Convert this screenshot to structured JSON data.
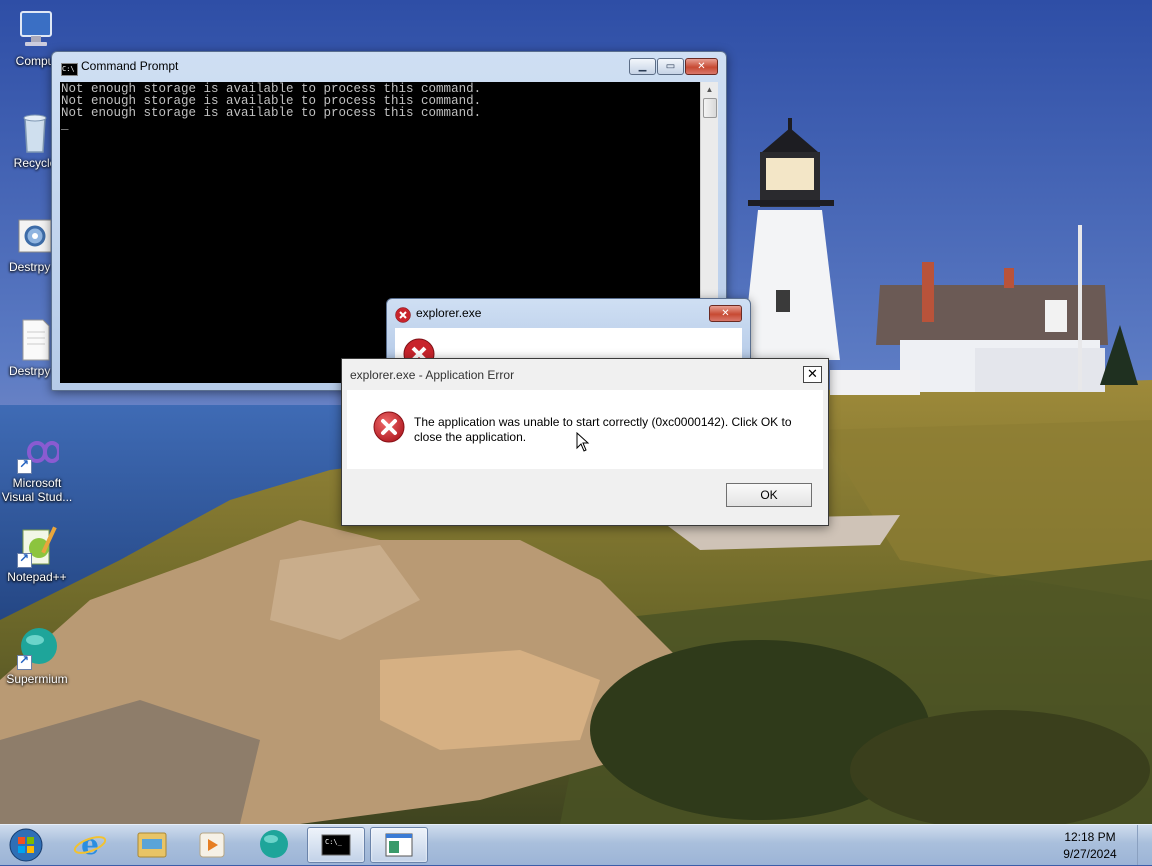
{
  "desktop": {
    "icons": [
      {
        "label": "Compu",
        "icon": "computer-icon"
      },
      {
        "label": "Recycle",
        "icon": "recycle-bin-icon"
      },
      {
        "label": "Destrpy F",
        "icon": "settings-app-icon"
      },
      {
        "label": "Destrpy F",
        "icon": "text-file-icon"
      },
      {
        "label": "Microsoft Visual Stud...",
        "icon": "visual-studio-icon"
      },
      {
        "label": "Notepad++",
        "icon": "notepad-plus-plus-icon"
      },
      {
        "label": "Supermium",
        "icon": "supermium-browser-icon"
      }
    ]
  },
  "cmd_window": {
    "title": "Command Prompt",
    "lines": [
      "Not enough storage is available to process this command.",
      "Not enough storage is available to process this command.",
      "Not enough storage is available to process this command.",
      "_"
    ]
  },
  "explorer_dialog": {
    "title": "explorer.exe"
  },
  "app_error_dialog": {
    "title": "explorer.exe - Application Error",
    "message": "The application was unable to start correctly (0xc0000142). Click OK to close the application.",
    "ok_label": "OK"
  },
  "taskbar": {
    "items": [
      "start-orb",
      "internet-explorer",
      "file-explorer",
      "media-player",
      "supermium",
      "command-prompt",
      "explorer-app"
    ],
    "time": "12:18 PM",
    "date": "9/27/2024"
  },
  "colors": {
    "error_red": "#c8242c",
    "console_bg": "#000000",
    "console_fg": "#c0c0c0"
  }
}
